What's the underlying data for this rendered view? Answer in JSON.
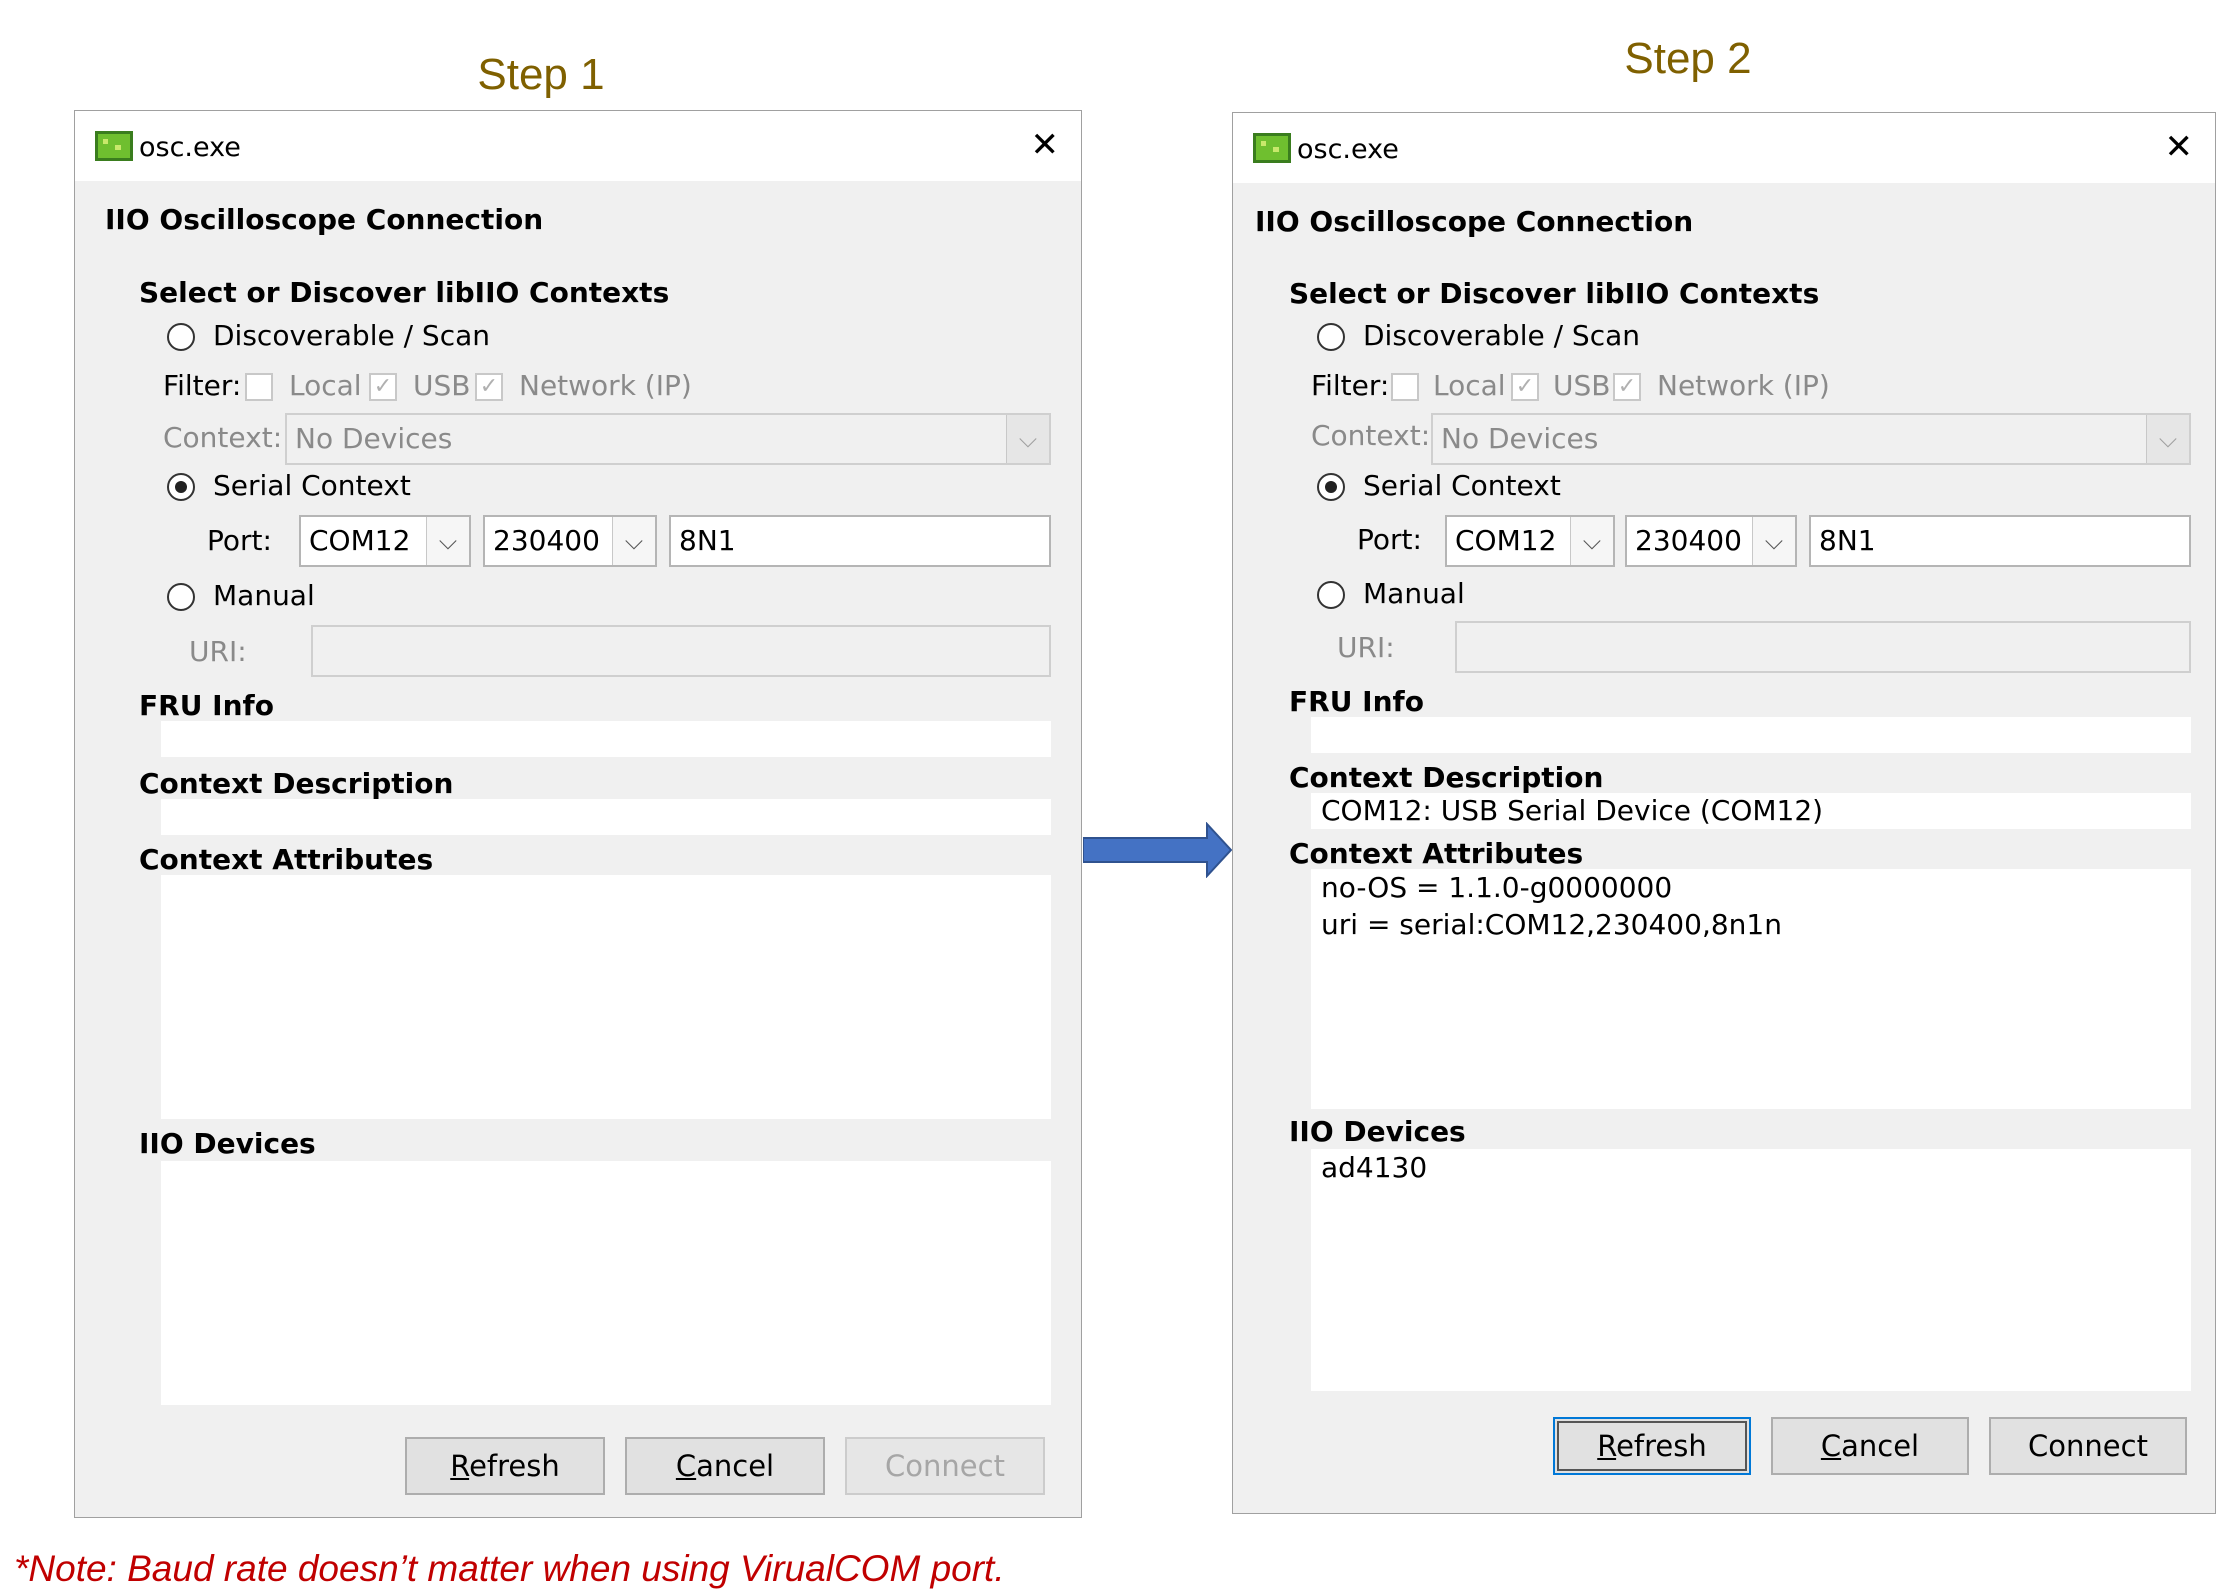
{
  "step1_title": "Step 1",
  "step2_title": "Step 2",
  "note": "*Note: Baud rate doesn’t matter when using VirualCOM port.",
  "colors": {
    "step_title": "#7f6000",
    "note": "#c00000",
    "arrow": "#4472c4"
  },
  "step1": {
    "window_title": "osc.exe",
    "heading": "IIO Oscilloscope Connection",
    "section_select": "Select or Discover libIIO Contexts",
    "discoverable_label": "Discoverable / Scan",
    "filter_label": "Filter:",
    "filter_local": "Local",
    "filter_usb": "USB",
    "filter_network": "Network (IP)",
    "context_label": "Context:",
    "context_value": "No Devices",
    "serial_label": "Serial Context",
    "port_label": "Port:",
    "port_value": "COM12",
    "baud_value": "230400",
    "format_value": "8N1",
    "manual_label": "Manual",
    "uri_label": "URI:",
    "fru_label": "FRU Info",
    "ctx_desc_label": "Context Description",
    "ctx_desc_value": "",
    "ctx_attr_label": "Context Attributes",
    "ctx_attr_line1": "",
    "ctx_attr_line2": "",
    "devices_label": "IIO Devices",
    "devices_value": "",
    "refresh_button": "Refresh",
    "cancel_button": "Cancel",
    "connect_button": "Connect"
  },
  "step2": {
    "window_title": "osc.exe",
    "heading": "IIO Oscilloscope Connection",
    "section_select": "Select or Discover libIIO Contexts",
    "discoverable_label": "Discoverable / Scan",
    "filter_label": "Filter:",
    "filter_local": "Local",
    "filter_usb": "USB",
    "filter_network": "Network (IP)",
    "context_label": "Context:",
    "context_value": "No Devices",
    "serial_label": "Serial Context",
    "port_label": "Port:",
    "port_value": "COM12",
    "baud_value": "230400",
    "format_value": "8N1",
    "manual_label": "Manual",
    "uri_label": "URI:",
    "fru_label": "FRU Info",
    "ctx_desc_label": "Context Description",
    "ctx_desc_value": "COM12: USB Serial Device (COM12)",
    "ctx_attr_label": "Context Attributes",
    "ctx_attr_line1": "no-OS = 1.1.0-g0000000",
    "ctx_attr_line2": "uri = serial:COM12,230400,8n1n",
    "devices_label": "IIO Devices",
    "devices_value": "ad4130",
    "refresh_button": "Refresh",
    "cancel_button": "Cancel",
    "connect_button": "Connect"
  }
}
